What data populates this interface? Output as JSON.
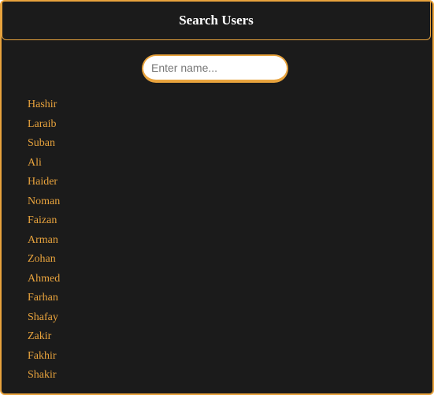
{
  "header": {
    "title": "Search Users"
  },
  "search": {
    "placeholder": "Enter name...",
    "value": ""
  },
  "users": [
    "Hashir",
    "Laraib",
    "Suban",
    "Ali",
    "Haider",
    "Noman",
    "Faizan",
    "Arman",
    "Zohan",
    "Ahmed",
    "Farhan",
    "Shafay",
    "Zakir",
    "Fakhir",
    "Shakir"
  ],
  "colors": {
    "accent": "#e8a33d",
    "background": "#1b1b1b",
    "title_text": "#ffffff"
  }
}
